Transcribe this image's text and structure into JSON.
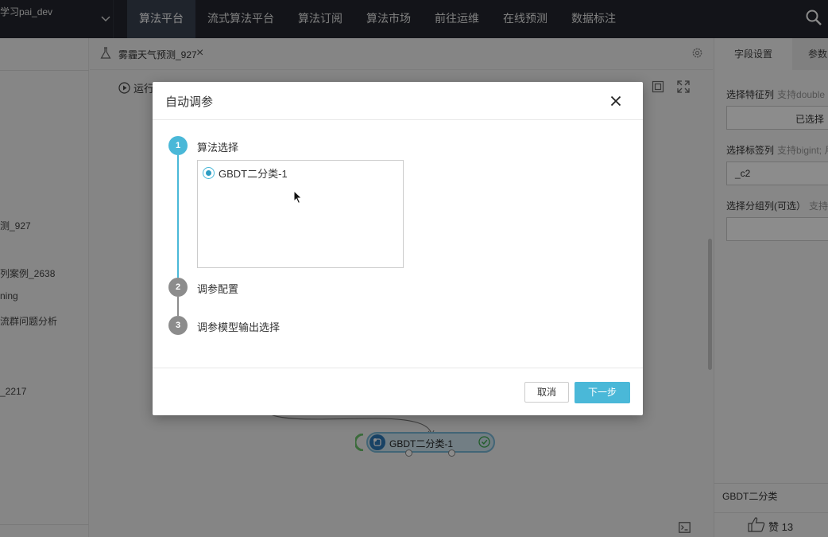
{
  "topbar": {
    "project_name": "学习pai_dev",
    "nav": [
      "算法平台",
      "流式算法平台",
      "算法订阅",
      "算法市场",
      "前往运维",
      "在线预测",
      "数据标注"
    ],
    "active_index": 0
  },
  "sidebar": {
    "items": [
      "测_927",
      "列案例_2638",
      "ning",
      "流群问题分析",
      "_2217"
    ]
  },
  "canvas": {
    "tab_title": "雾霾天气预测_927",
    "run_label": "运行",
    "node_label": "GBDT二分类-1"
  },
  "right_panel": {
    "tabs": [
      "字段设置",
      "参数"
    ],
    "feature_label": "选择特征列",
    "feature_hint": "支持double",
    "feature_value": "已选择",
    "label_label": "选择标签列",
    "label_hint": "支持bigint; 月",
    "label_value": "_c2",
    "group_label": "选择分组列(可选）",
    "group_hint": "支持",
    "bottom_title": "GBDT二分类",
    "like_text": "赞 13"
  },
  "modal": {
    "title": "自动调参",
    "steps": [
      {
        "number": "1",
        "label": "算法选择"
      },
      {
        "number": "2",
        "label": "调参配置"
      },
      {
        "number": "3",
        "label": "调参模型输出选择"
      }
    ],
    "algorithm_option": "GBDT二分类-1",
    "cancel_label": "取消",
    "next_label": "下一步"
  },
  "colors": {
    "accent": "#4ab8d8",
    "topbar": "#23262e",
    "step_inactive": "#8c8c8c"
  }
}
